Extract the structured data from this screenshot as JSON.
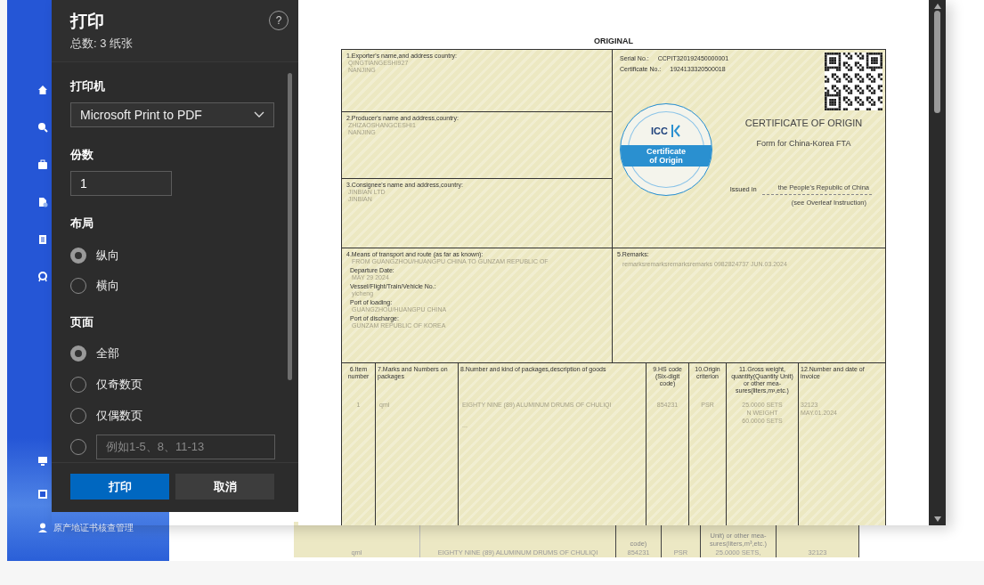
{
  "background_page": {
    "sidebar": {
      "bottom_item": "原产地证书核查管理"
    },
    "behind_sheet": {
      "cells": [
        {
          "value": "qml"
        },
        {
          "value": "EIGHTY NINE (89) ALUMINUM DRUMS OF CHULIQI"
        },
        {
          "header": "code)",
          "value": "854231"
        },
        {
          "value": "PSR"
        },
        {
          "header": "Unit) or other mea-sures(liters,m³,etc.)",
          "value": "25.0000 SETS,"
        },
        {
          "value": "32123"
        }
      ]
    }
  },
  "print_dialog": {
    "title": "打印",
    "subtitle": "总数: 3 纸张",
    "help": "?",
    "printer": {
      "label": "打印机",
      "value": "Microsoft Print to PDF"
    },
    "copies": {
      "label": "份数",
      "value": "1"
    },
    "layout": {
      "label": "布局",
      "options": [
        {
          "label": "纵向",
          "selected": true
        },
        {
          "label": "横向",
          "selected": false
        }
      ]
    },
    "pages": {
      "label": "页面",
      "options": [
        {
          "kind": "option",
          "label": "全部",
          "selected": true
        },
        {
          "kind": "option",
          "label": "仅奇数页",
          "selected": false
        },
        {
          "kind": "option",
          "label": "仅偶数页",
          "selected": false
        },
        {
          "kind": "range",
          "placeholder": "例如1-5、8、11-13",
          "selected": false
        }
      ]
    },
    "buttons": [
      {
        "label": "打印",
        "primary": true
      },
      {
        "label": "取消",
        "primary": false
      }
    ]
  },
  "certificate": {
    "heading": "ORIGINAL",
    "exporter": {
      "label": "1.Exporter's name,and address country:",
      "values": [
        "QINGTIANGESHI927",
        "NANJING"
      ]
    },
    "producer": {
      "label": "2.Producer's name and address,country:",
      "values": [
        "ZHIZAOSHANGCESHI1",
        "NANJING"
      ]
    },
    "consignee": {
      "label": "3.Consignee's name and address,country:",
      "values": [
        "JINBIAN LTD",
        "JINBIAN"
      ]
    },
    "serial": {
      "label": "Serial No.:",
      "value": "CCPIT320192450000001"
    },
    "certificate_no": {
      "label": "Certificate No.:",
      "value": "1924133320500018"
    },
    "seal": {
      "logo": "ICC",
      "band": "Certificate of Origin"
    },
    "title": "CERTIFICATE OF ORIGIN",
    "subtitle": "Form for China-Korea FTA",
    "issued": {
      "label": "Issued in",
      "value": "the People's Republic of China",
      "note": "(see Overleaf Instruction)"
    },
    "transport": {
      "label": "4.Means of transport and route (as far as known):",
      "lines": [
        {
          "kind": "value",
          "text": "FROM GUANGZHOU/HUANGPU CHINA TO GUNZAM REPUBLIC OF"
        },
        {
          "kind": "label",
          "text": "Departure Date:"
        },
        {
          "kind": "value",
          "text": "MAY 29 2024"
        },
        {
          "kind": "label",
          "text": "Vessel/Flight/Train/Vehicle No.:"
        },
        {
          "kind": "value",
          "text": "yicheng"
        },
        {
          "kind": "label",
          "text": "Port of loading:"
        },
        {
          "kind": "value",
          "text": "GUANGZHOU/HUANGPU CHINA"
        },
        {
          "kind": "label",
          "text": "Port of discharge:"
        },
        {
          "kind": "value",
          "text": "GUNZAM REPUBLIC OF KOREA"
        }
      ]
    },
    "remarks": {
      "label": "5.Remarks:",
      "values": [
        "remarksremarksremarksremarks 0982824737 JUN.03.2024"
      ]
    },
    "goods": {
      "columns": [
        "6.Item number",
        "7.Marks and Numbers on packages",
        "8.Number and kind of packages,description of goods",
        "9.HS code (Six-digit code)",
        "10.Origin criterion",
        "11.Gross weight, quantity(Quantity Unit) or other mea-sures(liters,m³,etc.)",
        "12.Number and date of invoice"
      ],
      "rows": [
        {
          "cells": [
            [
              "1"
            ],
            [
              "qml"
            ],
            [
              "EIGHTY NINE (89) ALUMINUM DRUMS OF CHULIQI",
              "..."
            ],
            [
              "854231"
            ],
            [
              "PSR"
            ],
            [
              "25.0000 SETS",
              "N WEIGHT",
              "60.0000 SETS"
            ],
            [
              "32123",
              "MAY.01.2024"
            ]
          ]
        }
      ]
    }
  }
}
